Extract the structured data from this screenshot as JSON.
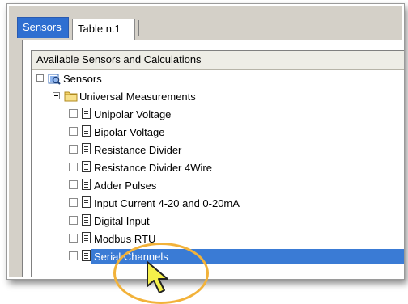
{
  "tabs": [
    {
      "label": "Sensors",
      "active": true
    },
    {
      "label": "Table n.1",
      "active": false
    }
  ],
  "tree": {
    "header": "Available Sensors and Calculations",
    "root": {
      "label": "Sensors",
      "icon": "sensors-tree-icon",
      "expanded": true
    },
    "group": {
      "label": "Universal Measurements",
      "icon": "folder-icon",
      "expanded": true
    },
    "items": [
      {
        "label": "Unipolar Voltage",
        "checked": false,
        "selected": false
      },
      {
        "label": "Bipolar Voltage",
        "checked": false,
        "selected": false
      },
      {
        "label": "Resistance Divider",
        "checked": false,
        "selected": false
      },
      {
        "label": "Resistance Divider 4Wire",
        "checked": false,
        "selected": false
      },
      {
        "label": "Adder Pulses",
        "checked": false,
        "selected": false
      },
      {
        "label": "Input Current 4-20 and 0-20mA",
        "checked": false,
        "selected": false
      },
      {
        "label": "Digital Input",
        "checked": false,
        "selected": false
      },
      {
        "label": "Modbus RTU",
        "checked": false,
        "selected": false
      },
      {
        "label": "Serial Channels",
        "checked": false,
        "selected": true
      }
    ]
  },
  "colors": {
    "selection": "#3a7bd5",
    "active_tab": "#2f6fd1",
    "highlight_circle": "#f2b23a",
    "cursor_fill": "#f5f04a"
  }
}
